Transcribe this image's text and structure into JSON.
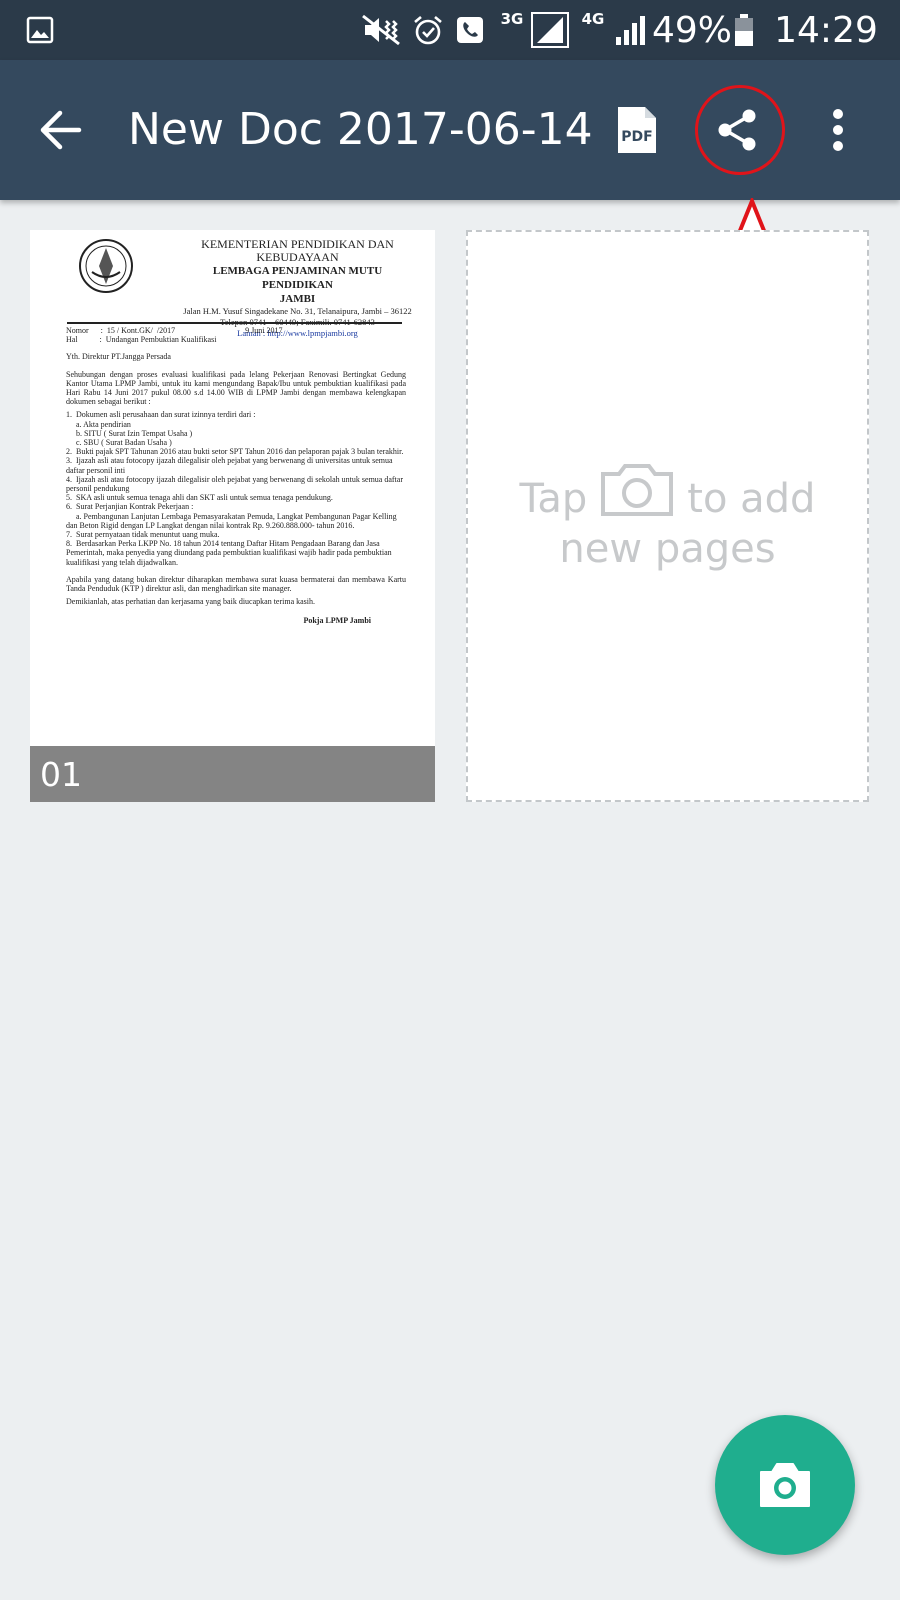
{
  "status_bar": {
    "network_3g": "3G",
    "network_4g": "4G",
    "battery": "49%",
    "time": "14:29",
    "icons": [
      "gallery-icon",
      "mute-vibrate-icon",
      "alarm-icon",
      "call-icon",
      "signal-icon",
      "signal-icon",
      "battery-icon"
    ]
  },
  "app_bar": {
    "title": "New Doc 2017-06-14",
    "pdf_label": "PDF",
    "icons": [
      "back-arrow-icon",
      "pdf-icon",
      "share-icon",
      "more-vert-icon"
    ]
  },
  "pages": [
    {
      "label": "01",
      "document": {
        "header_lines": [
          "KEMENTERIAN PENDIDIKAN DAN",
          "KEBUDAYAAN",
          "LEMBAGA PENJAMINAN MUTU PENDIDIKAN",
          "JAMBI",
          "Jalan H.M. Yusuf Singadekane No. 31, Telanaipura, Jambi – 36122",
          "Telepon 0741 – 60449; Faximili. 0741-62843",
          "Laman : http://www.lpmpjambi.org"
        ],
        "meta": [
          "Nomor      :  15 / Kont.GK/  /2017                                   9 Juni 2017",
          "Hal           :  Undangan Pembuktian Kualifikasi"
        ],
        "salutation": "Yth. Direktur PT.Jangga Persada",
        "intro": "Sehubungan dengan proses evaluasi kualifikasi pada lelang Pekerjaan Renovasi Bertingkat Gedung Kantor Utama LPMP Jambi, untuk itu kami mengundang Bapak/Ibu untuk pembuktian kualifikasi pada Hari Rabu 14 Juni 2017 pukul 08.00 s.d 14.00 WIB di LPMP Jambi dengan membawa kelengkapan dokumen sebagai berikut :",
        "items": [
          "1.  Dokumen asli perusahaan dan surat izinnya terdiri dari :",
          "     a. Akta pendirian",
          "     b. SITU ( Surat Izin Tempat Usaha )",
          "     c. SBU ( Surat Badan Usaha )",
          "2.  Bukti pajak SPT Tahunan 2016 atau bukti setor SPT Tahun 2016 dan pelaporan pajak 3 bulan terakhir.",
          "3.  Ijazah asli atau fotocopy ijazah dilegalisir oleh pejabat yang berwenang di universitas untuk semua daftar personil inti",
          "4.  Ijazah asli atau fotocopy ijazah dilegalisir oleh pejabat yang berwenang di sekolah untuk semua daftar personil pendukung",
          "5.  SKA asli untuk semua tenaga ahli dan SKT asli untuk semua tenaga pendukung.",
          "6.  Surat Perjanjian Kontrak Pekerjaan :",
          "     a. Pembangunan Lanjutan Lembaga Pemasyarakatan Pemuda, Langkat Pembangunan Pagar Kelling dan Beton Rigid dengan LP Langkat dengan nilai kontrak Rp. 9.260.888.000- tahun 2016.",
          "7.  Surat pernyataan tidak menuntut uang muka.",
          "8.  Berdasarkan Perka LKPP No. 18 tahun 2014 tentang Daftar Hitam Pengadaan Barang dan Jasa Pemerintah, maka penyedia yang diundang pada pembuktian kualifikasi wajib hadir pada pembuktian kualifikasi yang telah dijadwalkan."
        ],
        "closing_1": "Apabila yang datang bukan direktur diharapkan membawa surat kuasa bermaterai dan membawa Kartu Tanda Penduduk (KTP ) direktur asli, dan menghadirkan site manager.",
        "closing_2": "Demikianlah, atas perhatian dan kerjasama yang baik diucapkan terima kasih.",
        "signature": "Pokja LPMP Jambi"
      }
    }
  ],
  "add_page": {
    "hint_before": "Tap",
    "hint_after": "to add",
    "hint_line2": "new pages",
    "icon": "camera-icon"
  },
  "fab": {
    "icon": "camera-icon"
  },
  "colors": {
    "status_bar": "#2b3a49",
    "app_bar": "#34495e",
    "background": "#eceff1",
    "fab": "#1fae8e",
    "annotation": "#e0141a"
  }
}
